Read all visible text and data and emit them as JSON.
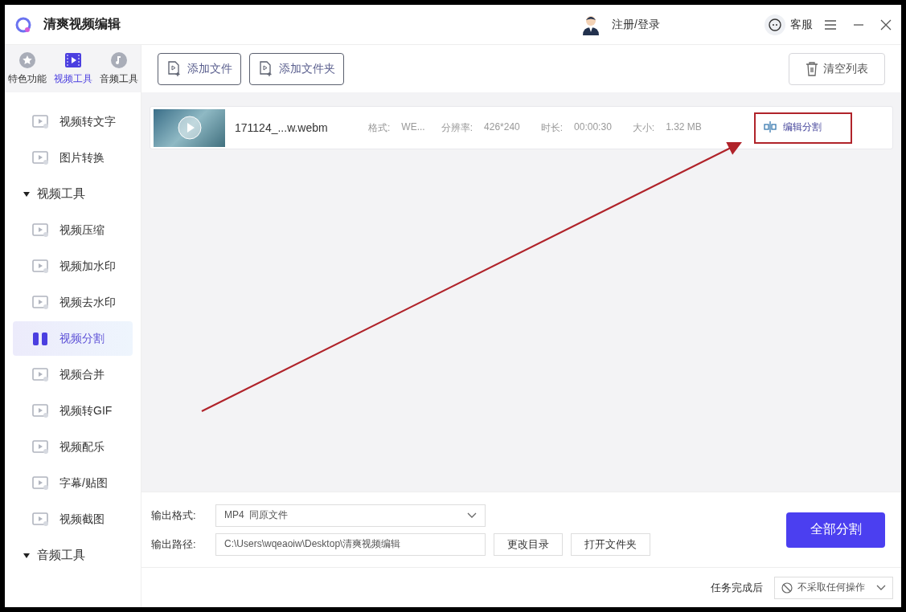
{
  "window": {
    "title": "清爽视频编辑",
    "login": "注册/登录",
    "support": "客服"
  },
  "sidebar": {
    "tabs": [
      {
        "label": "特色功能",
        "selected": false
      },
      {
        "label": "视频工具",
        "selected": true
      },
      {
        "label": "音频工具",
        "selected": false
      }
    ],
    "menu": [
      {
        "kind": "item",
        "label": "视频转文字",
        "selected": false
      },
      {
        "kind": "item",
        "label": "图片转换",
        "selected": false
      },
      {
        "kind": "group",
        "label": "视频工具",
        "expanded": true,
        "children": [
          {
            "kind": "item",
            "label": "视频压缩",
            "selected": false
          },
          {
            "kind": "item",
            "label": "视频加水印",
            "selected": false
          },
          {
            "kind": "item",
            "label": "视频去水印",
            "selected": false
          },
          {
            "kind": "item",
            "label": "视频分割",
            "selected": true
          },
          {
            "kind": "item",
            "label": "视频合并",
            "selected": false
          },
          {
            "kind": "item",
            "label": "视频转GIF",
            "selected": false
          },
          {
            "kind": "item",
            "label": "视频配乐",
            "selected": false
          },
          {
            "kind": "item",
            "label": "字幕/贴图",
            "selected": false
          },
          {
            "kind": "item",
            "label": "视频截图",
            "selected": false
          }
        ]
      },
      {
        "kind": "group",
        "label": "音频工具",
        "expanded": true
      }
    ]
  },
  "toolbar": {
    "buttons": [
      "添加文件",
      "添加文件夹"
    ],
    "clear": "清空列表"
  },
  "files": [
    {
      "name": "171124_...w.webm",
      "fields": [
        {
          "label": "格式:",
          "value": "WE..."
        },
        {
          "label": "分辨率:",
          "value": "426*240"
        },
        {
          "label": "时长:",
          "value": "00:00:30"
        },
        {
          "label": "大小:",
          "value": "1.32 MB"
        }
      ],
      "action": "编辑分割",
      "highlighted": true
    }
  ],
  "output": {
    "format_label": "输出格式:",
    "format": "MP4  同原文件",
    "path_label": "输出路径:",
    "path": "C:\\Users\\wqeaoiw\\Desktop\\清爽视频编辑",
    "buttons": [
      "更改目录",
      "打开文件夹"
    ],
    "start": "全部分割"
  },
  "status_bar": {
    "label": "任务完成后",
    "option": "不采取任何操作"
  }
}
